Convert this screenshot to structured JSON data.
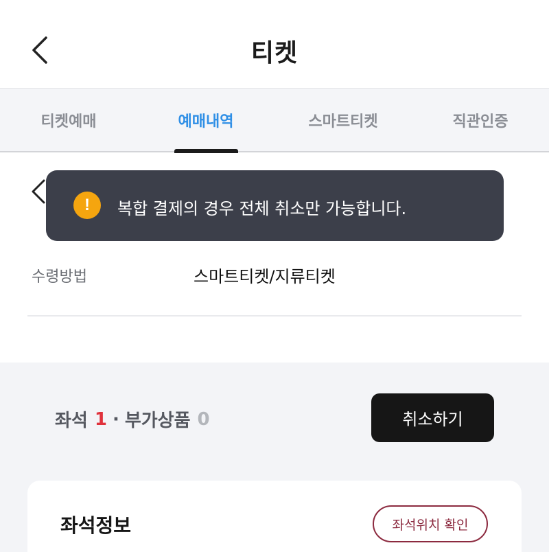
{
  "header": {
    "title": "티켓",
    "back_icon": "chevron-left-icon"
  },
  "tabs": [
    {
      "label": "티켓예매",
      "active": false
    },
    {
      "label": "예매내역",
      "active": true
    },
    {
      "label": "스마트티켓",
      "active": false
    },
    {
      "label": "직관인증",
      "active": false
    }
  ],
  "info": {
    "receive_label": "수령방법",
    "receive_value": "스마트티켓/지류티켓"
  },
  "summary": {
    "seat_label": "좌석",
    "seat_count": "1",
    "separator": "·",
    "addon_label": "부가상품",
    "addon_count": "0",
    "cancel_label": "취소하기"
  },
  "seat_card": {
    "title": "좌석정보",
    "location_button": "좌석위치 확인"
  },
  "toast": {
    "icon": "warning-icon",
    "icon_glyph": "!",
    "message": "복합 결제의 경우 전체 취소만 가능합니다."
  },
  "colors": {
    "accent_blue": "#2f8fe6",
    "count_red": "#e0323c",
    "toast_bg": "#3c3f4a",
    "warning_orange": "#f5a50f",
    "seat_button": "#8c2a3f"
  }
}
